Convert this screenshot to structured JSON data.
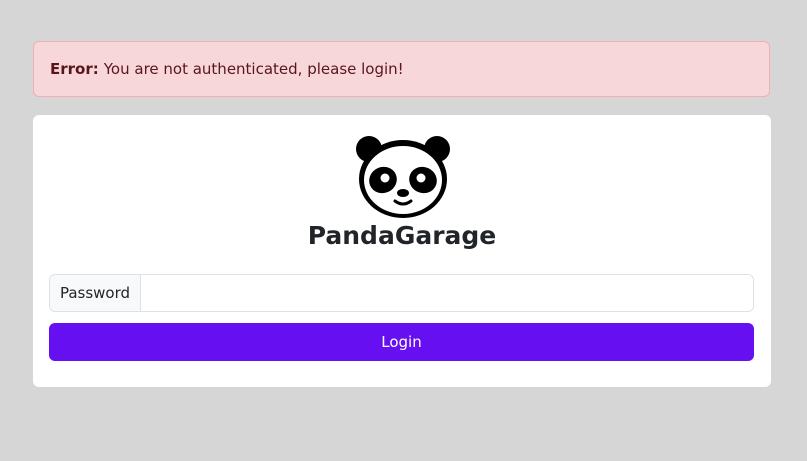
{
  "alert": {
    "label": "Error:",
    "message": "You are not authenticated, please login!"
  },
  "brand": {
    "name": "PandaGarage",
    "logo_icon": "panda-icon"
  },
  "form": {
    "password_label": "Password",
    "password_value": "",
    "login_label": "Login"
  },
  "colors": {
    "background": "#d6d6d6",
    "alert_bg": "#f8d7da",
    "alert_text": "#58151c",
    "button": "#6610f2",
    "card": "#ffffff"
  }
}
